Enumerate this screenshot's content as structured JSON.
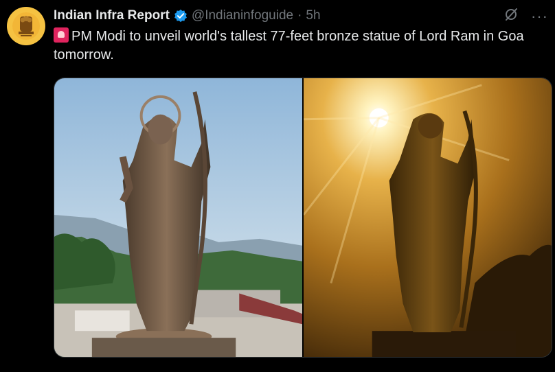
{
  "tweet": {
    "author": "Indian Infra Report",
    "handle": "@Indianinfoguide",
    "separator": "·",
    "time": "5h",
    "text": "PM Modi to unveil world's tallest 77-feet bronze statue of Lord Ram in Goa tomorrow.",
    "emoji_icon": "police-siren-icon",
    "verified_color": "#1d9bf0"
  },
  "images": [
    {
      "name": "statue-daylight-photo",
      "icon": "image"
    },
    {
      "name": "statue-golden-sunlight-photo",
      "icon": "image"
    }
  ],
  "colors": {
    "background": "#000000",
    "text": "#e7e9ea",
    "muted": "#71767b",
    "avatar_bg": "#f5c242"
  }
}
